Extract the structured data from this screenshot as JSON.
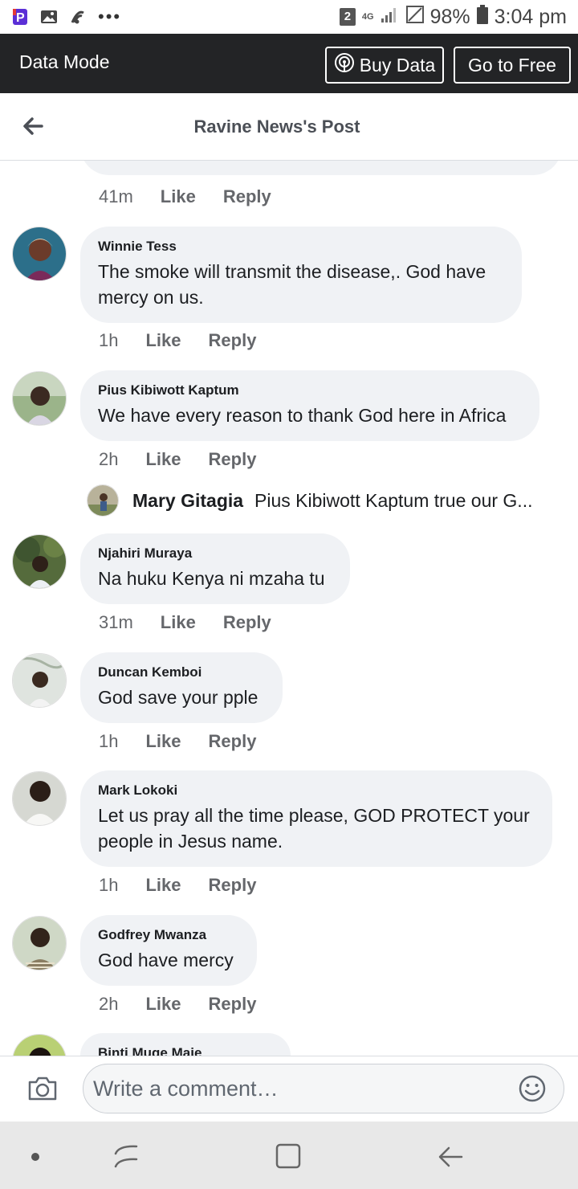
{
  "status_bar": {
    "notification_badge": "2",
    "network": "4G",
    "battery": "98%",
    "time": "3:04 pm"
  },
  "data_mode": {
    "title": "Data Mode",
    "buy_label": "Buy Data",
    "free_label": "Go to Free"
  },
  "header": {
    "title": "Ravine News's Post"
  },
  "like_label": "Like",
  "reply_label": "Reply",
  "top_partial": {
    "time": "41m"
  },
  "comments": [
    {
      "name": "Winnie Tess",
      "text": "The smoke will transmit the disease,. God have mercy on us.",
      "time": "1h"
    },
    {
      "name": "Pius Kibiwott Kaptum",
      "text": "We have every reason to thank God here in Africa",
      "time": "2h"
    },
    {
      "name": "Njahiri Muraya",
      "text": "Na huku Kenya ni mzaha tu",
      "time": "31m"
    },
    {
      "name": "Duncan Kemboi",
      "text": "God save your pple",
      "time": "1h"
    },
    {
      "name": "Mark Lokoki",
      "text": "Let us pray all the time please, GOD PROTECT your people in Jesus name.",
      "time": "1h"
    },
    {
      "name": "Godfrey Mwanza",
      "text": "God have mercy",
      "time": "2h"
    },
    {
      "name": "Binti Muge Maje",
      "text": "",
      "time": ""
    }
  ],
  "reply_preview": {
    "name": "Mary Gitagia",
    "text": "Pius Kibiwott Kaptum true our G..."
  },
  "composer": {
    "placeholder": "Write a comment…"
  },
  "icons": {
    "status_left": [
      "pinterest-icon",
      "gallery-icon",
      "signal-app-icon",
      "more-dots-icon"
    ],
    "composer": [
      "camera-icon",
      "emoji-icon"
    ],
    "nav": [
      "nav-dot-icon",
      "recents-icon",
      "home-icon",
      "back-nav-icon"
    ]
  },
  "colors": {
    "data_bar": "#232426",
    "bubble": "#f0f2f5",
    "meta_text": "#65676b"
  }
}
